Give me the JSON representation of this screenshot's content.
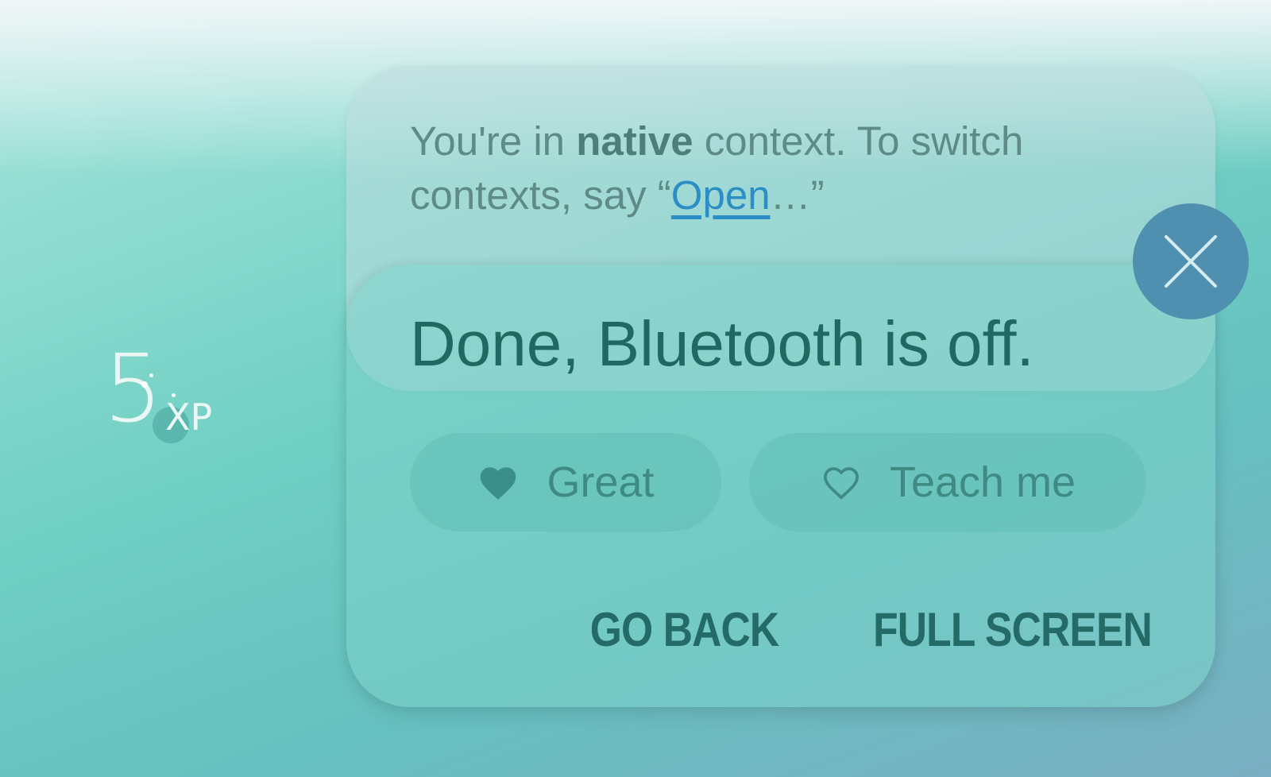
{
  "xp_badge": {
    "value": "5",
    "unit": "XP"
  },
  "context_card": {
    "text_prefix": "You're in ",
    "text_bold": "native",
    "text_middle": " context. To switch contexts, say “",
    "link_label": "Open",
    "text_suffix": "…”"
  },
  "response_card": {
    "title": "Done, Bluetooth is off.",
    "chips": {
      "great_label": "Great",
      "great_icon": "heart-filled-icon",
      "teach_label": "Teach me",
      "teach_icon": "heart-outline-icon"
    },
    "actions": {
      "go_back_label": "GO BACK",
      "full_screen_label": "FULL SCREEN"
    }
  },
  "close_button": {
    "icon": "close-icon"
  },
  "colors": {
    "title": "#1e6a62",
    "context_text": "#5e8b87",
    "link": "#2b8ec4",
    "close_button_bg": "#4f8fb0",
    "action_text": "#246a66",
    "chip_text": "#3f8b84"
  }
}
